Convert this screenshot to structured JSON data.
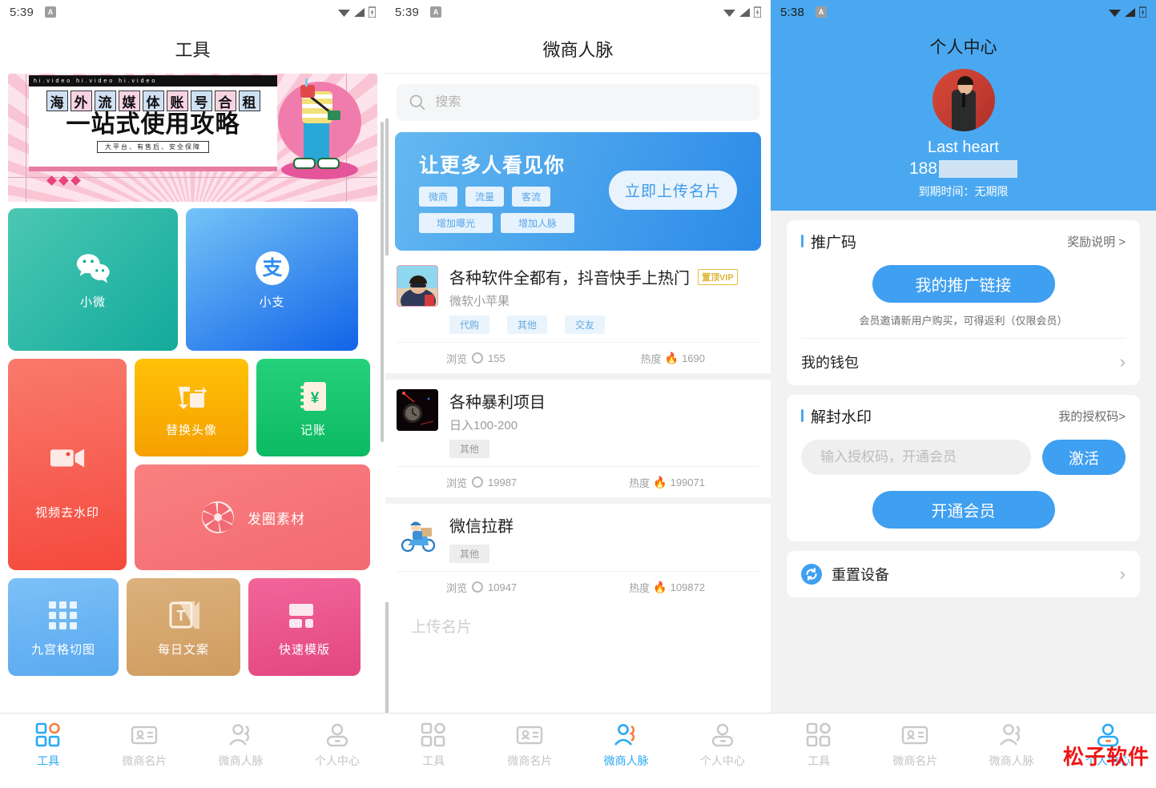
{
  "panel1": {
    "status": {
      "time": "5:39",
      "app_icon": "A"
    },
    "title": "工具",
    "banner": {
      "top_strip": "hi.video  hi.video  hi.video",
      "headline_chars": [
        "海",
        "外",
        "流",
        "媒",
        "体",
        "账",
        "号",
        "合",
        "租"
      ],
      "subhead": "一站式使用攻略",
      "tagline": "大平台、有售后、安全保障"
    },
    "tiles": [
      {
        "label": "小微",
        "icon": "wechat-icon",
        "color": "#12aa9b"
      },
      {
        "label": "小支",
        "icon": "alipay-icon",
        "color": "#1263e8"
      },
      {
        "label": "视频去水印",
        "icon": "video-camera-icon",
        "color": "#f5493d"
      },
      {
        "label": "替换头像",
        "icon": "swap-image-icon",
        "color": "#f5a000"
      },
      {
        "label": "记账",
        "icon": "ledger-yen-icon",
        "color": "#0cba63"
      },
      {
        "label": "发圈素材",
        "icon": "aperture-icon",
        "color": "#f26a72"
      },
      {
        "label": "九宫格切图",
        "icon": "grid-nine-icon",
        "color": "#5aa9f0"
      },
      {
        "label": "每日文案",
        "icon": "text-doc-icon",
        "color": "#cf9c5f"
      },
      {
        "label": "快速模版",
        "icon": "template-icon",
        "color": "#e2477f"
      }
    ],
    "nav": {
      "active_index": 0,
      "items": [
        {
          "label": "工具",
          "icon": "grid-icon"
        },
        {
          "label": "微商名片",
          "icon": "id-card-icon"
        },
        {
          "label": "微商人脉",
          "icon": "people-icon"
        },
        {
          "label": "个人中心",
          "icon": "person-icon"
        }
      ]
    }
  },
  "panel2": {
    "status": {
      "time": "5:39",
      "app_icon": "A"
    },
    "title": "微商人脉",
    "search": {
      "placeholder": "搜索",
      "value": "",
      "icon": "search-icon"
    },
    "promo": {
      "headline": "让更多人看见你",
      "chips_row1": [
        "微商",
        "流量",
        "客流"
      ],
      "chips_row2": [
        "增加曝光",
        "增加人脉"
      ],
      "cta": "立即上传名片"
    },
    "list_labels": {
      "views": "浏览",
      "heat": "热度"
    },
    "cards": [
      {
        "title": "各种软件全都有，抖音快手上热门",
        "badge": "置顶VIP",
        "subtitle": "微软小苹果",
        "tags": [
          "代购",
          "其他",
          "交友"
        ],
        "tag_style": "blue",
        "views": "155",
        "heat": "1690",
        "thumb": "beach-selfie-avatar"
      },
      {
        "title": "各种暴利项目",
        "badge": "",
        "subtitle": "日入100-200",
        "tags": [
          "其他"
        ],
        "tag_style": "grey",
        "views": "19987",
        "heat": "199071",
        "thumb": "dark-clock-photo"
      },
      {
        "title": "微信拉群",
        "badge": "",
        "subtitle": "",
        "tags": [
          "其他"
        ],
        "tag_style": "grey",
        "views": "10947",
        "heat": "109872",
        "thumb": "delivery-rider-icon"
      }
    ],
    "footer_hint": "上传名片",
    "nav": {
      "active_index": 2,
      "items": [
        {
          "label": "工具",
          "icon": "grid-icon"
        },
        {
          "label": "微商名片",
          "icon": "id-card-icon"
        },
        {
          "label": "微商人脉",
          "icon": "people-icon"
        },
        {
          "label": "个人中心",
          "icon": "person-icon"
        }
      ]
    }
  },
  "panel3": {
    "status": {
      "time": "5:38",
      "app_icon": "A"
    },
    "title": "个人中心",
    "profile": {
      "name": "Last heart",
      "phone_prefix": "188",
      "expiry": "到期时间：无期限",
      "avatar": "user-avatar"
    },
    "promo_card": {
      "heading": "推广码",
      "link": "奖励说明 >",
      "button": "我的推广链接",
      "hint": "会员邀请新用户购买，可得返利（仅限会员）",
      "wallet_row": "我的钱包"
    },
    "unlock_card": {
      "heading": "解封水印",
      "link": "我的授权码>",
      "input_placeholder": "输入授权码，开通会员",
      "input_value": "",
      "activate_button": "激活",
      "member_button": "开通会员"
    },
    "reset_row": {
      "label": "重置设备",
      "icon": "refresh-icon"
    },
    "watermark": "松子软件",
    "nav": {
      "active_index": 3,
      "items": [
        {
          "label": "工具",
          "icon": "grid-icon"
        },
        {
          "label": "微商名片",
          "icon": "id-card-icon"
        },
        {
          "label": "微商人脉",
          "icon": "people-icon"
        },
        {
          "label": "个人中心",
          "icon": "person-icon"
        }
      ]
    }
  },
  "colors": {
    "accent_blue": "#29a8f5",
    "accent_orange": "#f5803e",
    "button_blue": "#3f9ff0",
    "header_blue": "#4aa8f0",
    "watermark_red": "#f01414"
  }
}
